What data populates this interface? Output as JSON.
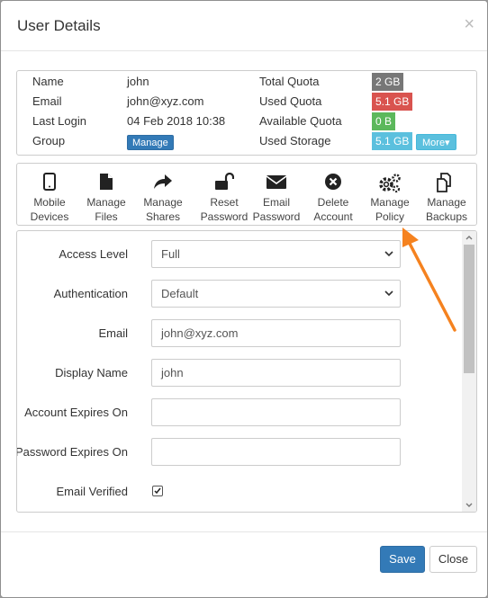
{
  "dialog": {
    "title": "User Details",
    "close_glyph": "×"
  },
  "info": {
    "name_label": "Name",
    "name_value": "john",
    "email_label": "Email",
    "email_value": "john@xyz.com",
    "last_login_label": "Last Login",
    "last_login_value": "04 Feb 2018 10:38",
    "group_label": "Group",
    "group_button": "Manage",
    "total_quota_label": "Total Quota",
    "total_quota_value": "2 GB",
    "used_quota_label": "Used Quota",
    "used_quota_value": "5.1 GB",
    "available_quota_label": "Available Quota",
    "available_quota_value": "0 B",
    "used_storage_label": "Used Storage",
    "used_storage_value": "5.1 GB",
    "more_button": "More▾",
    "colors": {
      "total": "#777777",
      "used": "#d9534f",
      "available": "#5cb85c",
      "storage": "#5bc0de"
    }
  },
  "toolbar": {
    "items": [
      {
        "line1": "Mobile",
        "line2": "Devices",
        "icon": "tablet-icon"
      },
      {
        "line1": "Manage",
        "line2": "Files",
        "icon": "file-icon"
      },
      {
        "line1": "Manage",
        "line2": "Shares",
        "icon": "share-icon"
      },
      {
        "line1": "Reset",
        "line2": "Password",
        "icon": "unlock-icon"
      },
      {
        "line1": "Email",
        "line2": "Password",
        "icon": "envelope-icon"
      },
      {
        "line1": "Delete",
        "line2": "Account",
        "icon": "delete-icon"
      },
      {
        "line1": "Manage",
        "line2": "Policy",
        "icon": "gears-icon"
      },
      {
        "line1": "Manage",
        "line2": "Backups",
        "icon": "copy-icon"
      }
    ]
  },
  "form": {
    "access_level_label": "Access Level",
    "access_level_value": "Full",
    "authentication_label": "Authentication",
    "authentication_value": "Default",
    "email_label": "Email",
    "email_value": "john@xyz.com",
    "display_name_label": "Display Name",
    "display_name_value": "john",
    "account_expires_label": "Account Expires On",
    "account_expires_value": "",
    "password_expires_label": "Password Expires On",
    "password_expires_value": "",
    "email_verified_label": "Email Verified",
    "email_verified_checked": true
  },
  "footer": {
    "save_label": "Save",
    "close_label": "Close"
  },
  "annotation": {
    "arrow_color": "#f5821f"
  }
}
